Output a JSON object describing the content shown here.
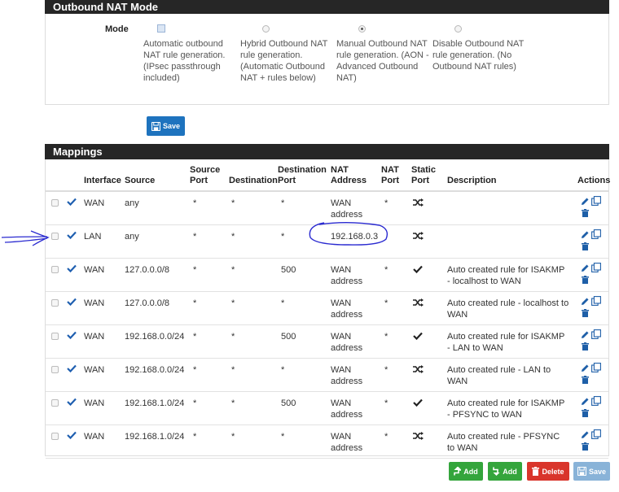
{
  "nat_mode": {
    "title": "Outbound NAT Mode",
    "mode_label": "Mode",
    "options": [
      {
        "text": "Automatic outbound NAT rule generation. (IPsec passthrough included)",
        "control": "checkbox"
      },
      {
        "text": "Hybrid Outbound NAT rule generation. (Automatic Outbound NAT + rules below)",
        "control": "radio"
      },
      {
        "text": "Manual Outbound NAT rule generation. (AON - Advanced Outbound NAT)",
        "control": "radio",
        "selected": true
      },
      {
        "text": "Disable Outbound NAT rule generation. (No Outbound NAT rules)",
        "control": "radio"
      }
    ],
    "save_label": "Save"
  },
  "mappings": {
    "title": "Mappings",
    "headers": {
      "interface": "Interface",
      "source": "Source",
      "source_port": "Source Port",
      "destination": "Destination",
      "destination_port": "Destination Port",
      "nat_address": "NAT Address",
      "nat_port": "NAT Port",
      "static_port": "Static Port",
      "description": "Description",
      "actions": "Actions"
    },
    "rows": [
      {
        "interface": "WAN",
        "source": "any",
        "source_port": "*",
        "destination": "*",
        "destination_port": "*",
        "nat_address": "WAN address",
        "nat_port": "*",
        "static": "shuffle-icon",
        "description": ""
      },
      {
        "interface": "LAN",
        "source": "any",
        "source_port": "*",
        "destination": "*",
        "destination_port": "*",
        "nat_address": "192.168.0.3",
        "nat_port": "",
        "static": "shuffle-icon",
        "description": ""
      },
      {
        "interface": "WAN",
        "source": "127.0.0.0/8",
        "source_port": "*",
        "destination": "*",
        "destination_port": "500",
        "nat_address": "WAN address",
        "nat_port": "*",
        "static": "check-icon",
        "description": "Auto created rule for ISAKMP - localhost to WAN"
      },
      {
        "interface": "WAN",
        "source": "127.0.0.0/8",
        "source_port": "*",
        "destination": "*",
        "destination_port": "*",
        "nat_address": "WAN address",
        "nat_port": "*",
        "static": "shuffle-icon",
        "description": "Auto created rule - localhost to WAN"
      },
      {
        "interface": "WAN",
        "source": "192.168.0.0/24",
        "source_port": "*",
        "destination": "*",
        "destination_port": "500",
        "nat_address": "WAN address",
        "nat_port": "*",
        "static": "check-icon",
        "description": "Auto created rule for ISAKMP - LAN to WAN"
      },
      {
        "interface": "WAN",
        "source": "192.168.0.0/24",
        "source_port": "*",
        "destination": "*",
        "destination_port": "*",
        "nat_address": "WAN address",
        "nat_port": "*",
        "static": "shuffle-icon",
        "description": "Auto created rule - LAN to WAN"
      },
      {
        "interface": "WAN",
        "source": "192.168.1.0/24",
        "source_port": "*",
        "destination": "*",
        "destination_port": "500",
        "nat_address": "WAN address",
        "nat_port": "*",
        "static": "check-icon",
        "description": "Auto created rule for ISAKMP - PFSYNC to WAN"
      },
      {
        "interface": "WAN",
        "source": "192.168.1.0/24",
        "source_port": "*",
        "destination": "*",
        "destination_port": "*",
        "nat_address": "WAN address",
        "nat_port": "*",
        "static": "shuffle-icon",
        "description": "Auto created rule - PFSYNC to WAN"
      }
    ]
  },
  "buttons": {
    "add_top": "Add",
    "add_bottom": "Add",
    "delete": "Delete",
    "save": "Save"
  },
  "colors": {
    "header_bg": "#262626",
    "primary": "#1e73be",
    "success": "#34a53c",
    "danger": "#d9352b",
    "annotation": "#2a2ad0"
  }
}
